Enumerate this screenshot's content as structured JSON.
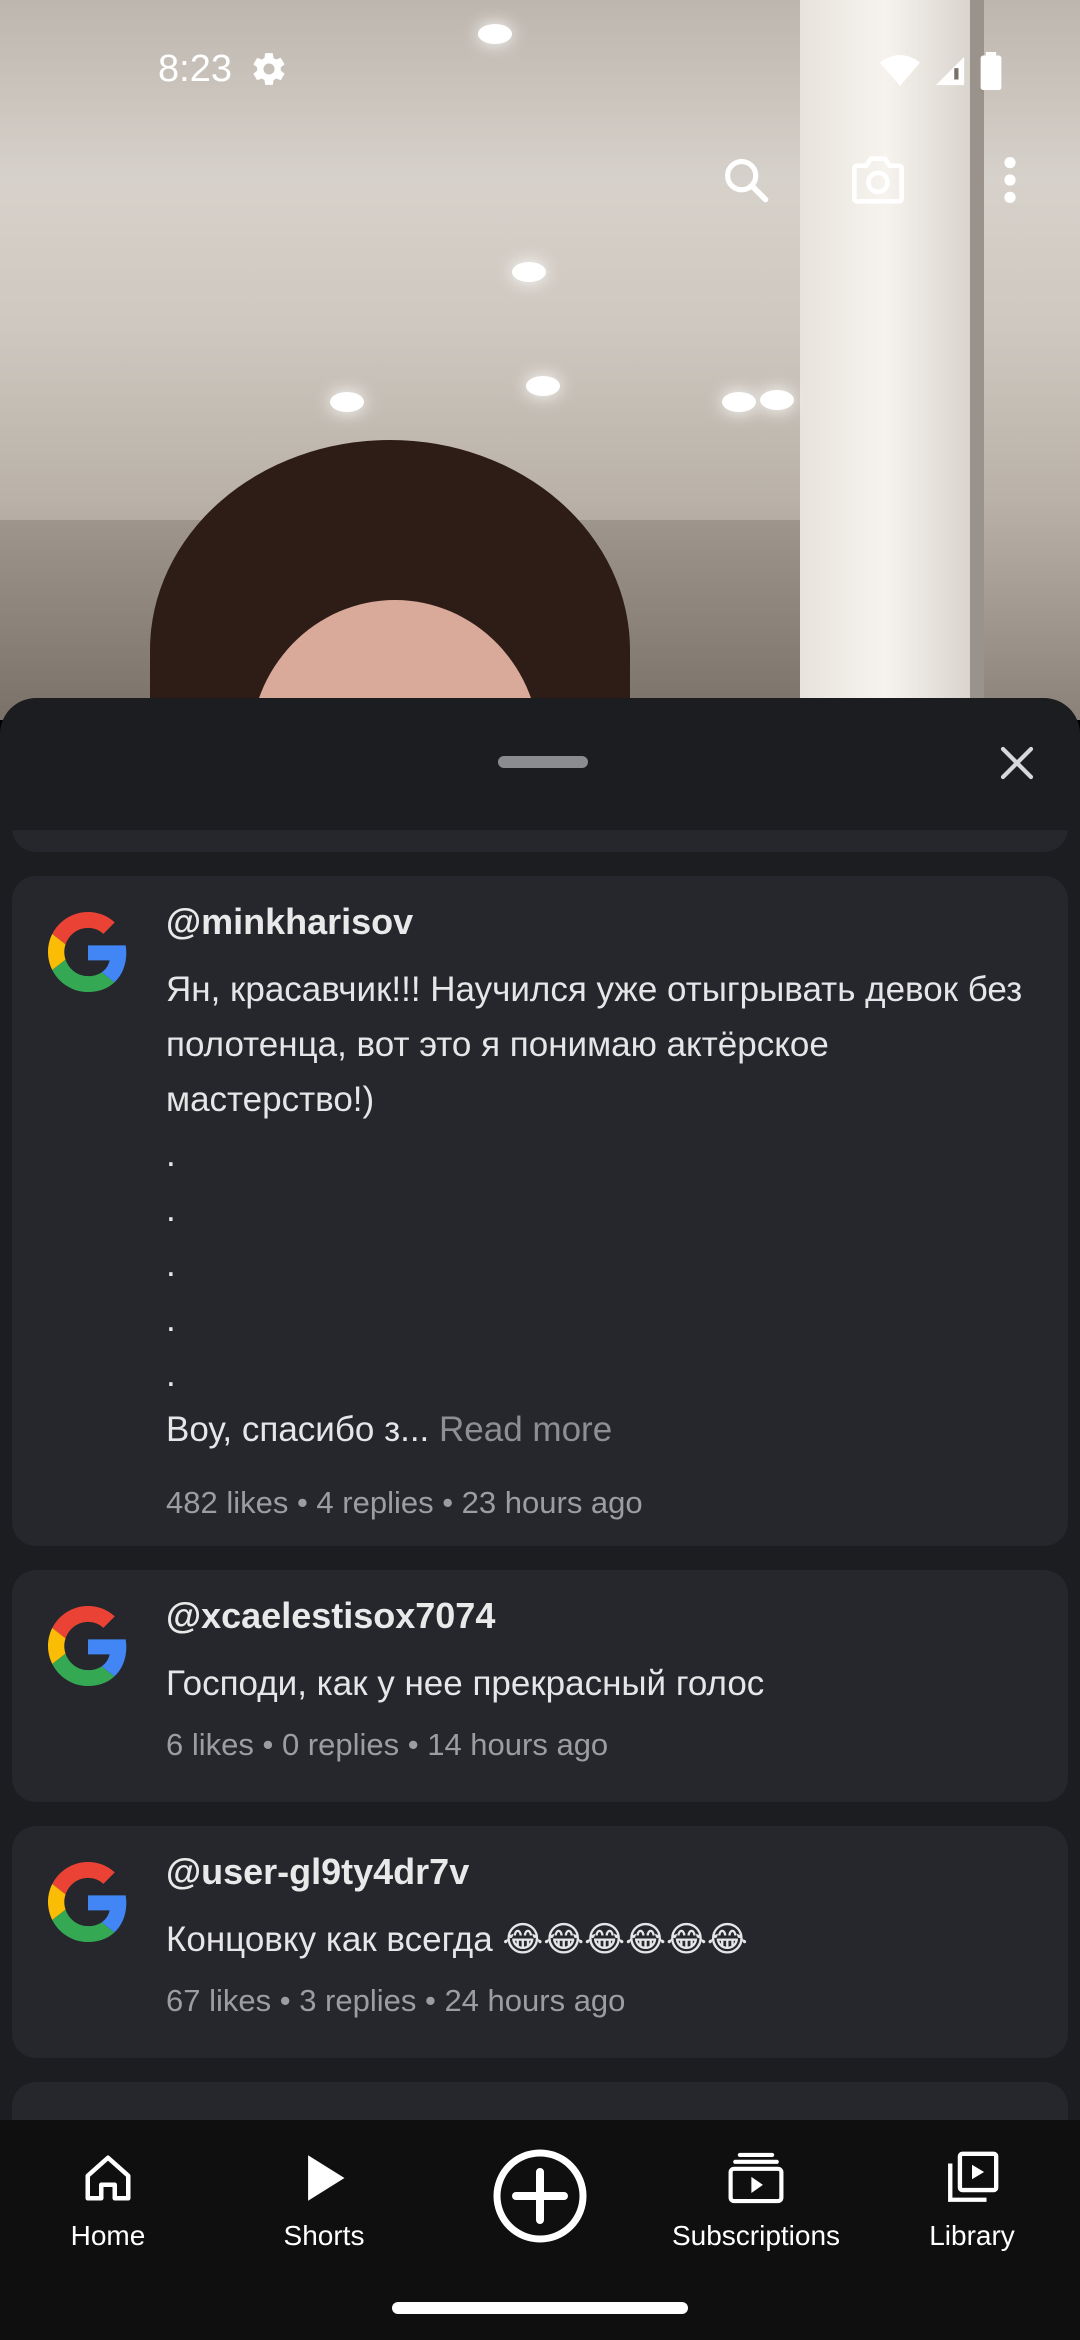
{
  "status_bar": {
    "time": "8:23"
  },
  "sheet": {
    "comments": [
      {
        "author": "@minkharisov",
        "text": "Ян, красавчик!!! Научился уже отыгрывать девок без полотенца, вот это я понимаю актёрское мастерство!)\n.\n.\n.\n.\n.\nВоу, спасибо з...",
        "read_more": "Read more",
        "meta": "482 likes • 4 replies • 23 hours ago"
      },
      {
        "author": "@xcaelestisox7074",
        "text": "Господи, как у нее прекрасный голос",
        "meta": "6 likes • 0 replies • 14 hours ago"
      },
      {
        "author": "@user-gl9ty4dr7v",
        "text": "Концовку как всегда 😂😂😂😂😂😂",
        "meta": "67 likes • 3 replies • 24 hours ago"
      }
    ]
  },
  "bottom_nav": {
    "items": [
      {
        "label": "Home",
        "icon": "home-icon"
      },
      {
        "label": "Shorts",
        "icon": "play-icon"
      },
      {
        "label": "",
        "icon": "create-icon"
      },
      {
        "label": "Subscriptions",
        "icon": "subscriptions-icon"
      },
      {
        "label": "Library",
        "icon": "library-icon"
      }
    ]
  }
}
